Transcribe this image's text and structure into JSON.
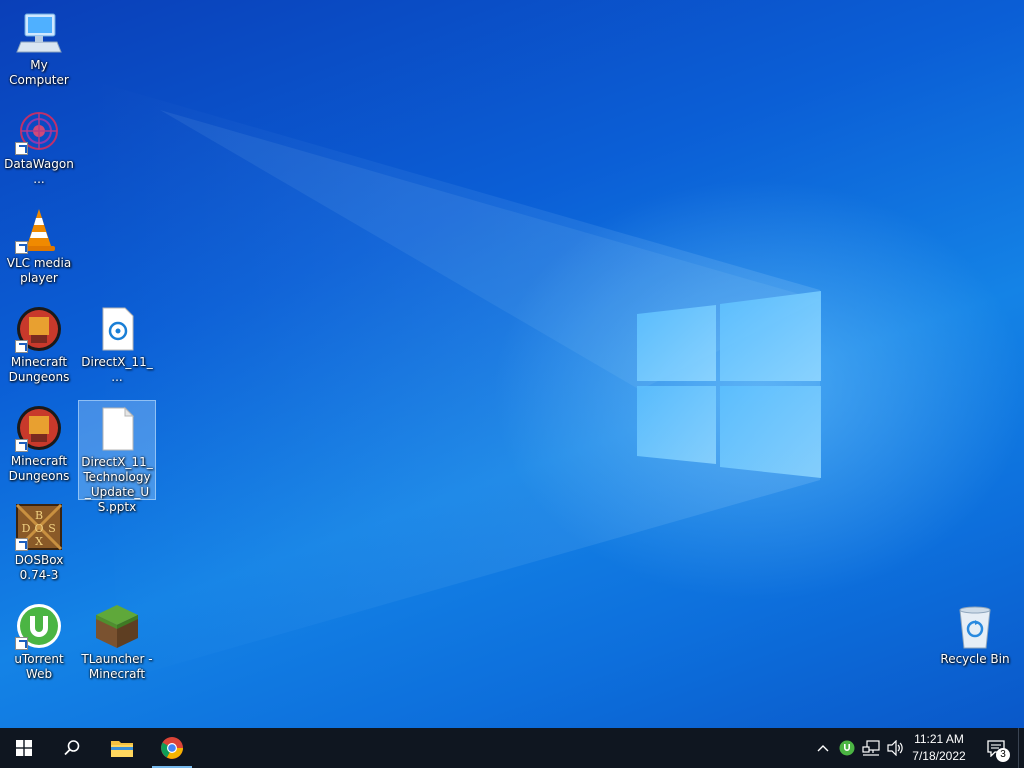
{
  "desktop": {
    "icons": [
      {
        "label": "My Computer"
      },
      {
        "label": "DataWagon..."
      },
      {
        "label": "VLC media player"
      },
      {
        "label": "Minecraft Dungeons"
      },
      {
        "label": "DirectX_11_..."
      },
      {
        "label": "Minecraft Dungeons"
      },
      {
        "label": "DirectX_11_Technology_Update_US.pptx"
      },
      {
        "label": "DOSBox 0.74-3"
      },
      {
        "label": "uTorrent Web"
      },
      {
        "label": "TLauncher - Minecraft"
      },
      {
        "label": "Recycle Bin"
      }
    ]
  },
  "taskbar": {
    "clock_time": "11:21 AM",
    "clock_date": "7/18/2022",
    "notification_count": "3"
  },
  "colors": {
    "accent": "#76b9ed",
    "taskbar": "#0f1620",
    "desktop": "#0b6fdc"
  }
}
